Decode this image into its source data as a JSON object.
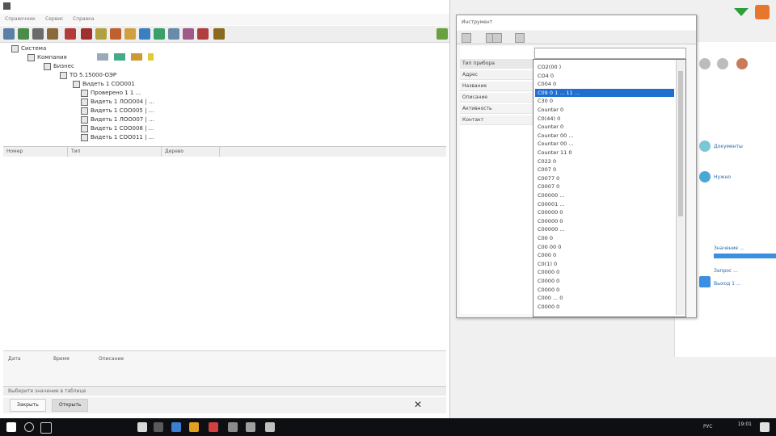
{
  "main_window": {
    "title": "",
    "menu": [
      "Справочник",
      "Сервис",
      "Справка"
    ],
    "tree": {
      "root": "Система",
      "level1": "Компания",
      "level2": "Бизнес",
      "level3": "ТО 5.15000-ОЭР",
      "items": [
        "Видеть 1 СОО001",
        "Проверено 1 1 ...",
        "Видеть 1 ЛОО004 | ...",
        "Видеть 1 СОО005 | ...",
        "Видеть 1 ЛОО007 | ...",
        "Видеть 1 СОО008 | ...",
        "Видеть 1 СОО011 | ..."
      ]
    },
    "grid_columns": [
      "Номер",
      "Тип",
      "Дерево"
    ],
    "bottom_panel_labels": [
      "Дата",
      "Время",
      "Описание"
    ],
    "status_text": "Выберите значение в таблице",
    "bottom_tabs": [
      "Закрыть",
      "Открыть"
    ]
  },
  "dialog": {
    "title": "Инструмент",
    "form_rows": [
      "Тип прибора",
      "Адрес",
      "Название",
      "Описание",
      "Активность",
      "Контакт"
    ],
    "combo_value": "",
    "list": [
      "CO2(00 )",
      "CO4 0",
      "C004 0",
      "C09 0  1 ... 11 ...",
      "C30 0",
      "Counter 0",
      "C0(44) 0",
      "Counter 0",
      "Counter 00 ...",
      "Counter 00 ...",
      "Counter 11 0",
      "C022 0",
      "C007 0",
      "C0077 0",
      "C0007 0",
      "C00000 ...",
      "C00001 ...",
      "C00000 0",
      "C00000 0",
      "C00000 ...",
      "C00 0",
      "C00 00 0",
      "C000 0",
      "C0(1) 0",
      "C0000 0",
      "C0000 0",
      "C0000 0",
      "C000 ... 0",
      "C0000 0"
    ],
    "selected_index": 3
  },
  "right_panel": {
    "entries": [
      "Документы",
      "Нужно",
      "Значение ...",
      "Запрос ...",
      "Выход 1 ..."
    ]
  },
  "taskbar": {
    "time": "19:01",
    "date": "",
    "lang": "РУС"
  },
  "colors": {
    "selection": "#1e6fd0",
    "taskbar": "#0e0f12",
    "accent_green": "#2e9e3a",
    "accent_orange": "#e8772e"
  }
}
